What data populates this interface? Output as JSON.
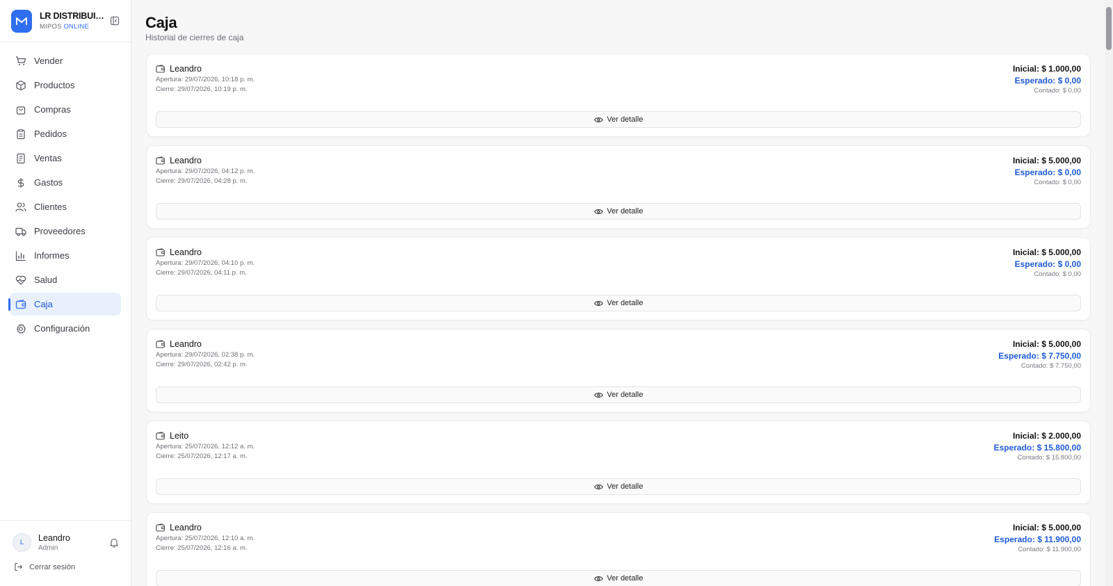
{
  "brand": {
    "name": "LR DISTRIBUIDORA",
    "sub_prefix": "MIPOS",
    "sub_highlight": "ONLINE"
  },
  "nav": [
    {
      "label": "Vender",
      "icon": "cart-icon"
    },
    {
      "label": "Productos",
      "icon": "box-icon"
    },
    {
      "label": "Compras",
      "icon": "shopping-bag-icon"
    },
    {
      "label": "Pedidos",
      "icon": "clipboard-icon"
    },
    {
      "label": "Ventas",
      "icon": "receipt-icon"
    },
    {
      "label": "Gastos",
      "icon": "dollar-icon"
    },
    {
      "label": "Clientes",
      "icon": "users-icon"
    },
    {
      "label": "Proveedores",
      "icon": "truck-icon"
    },
    {
      "label": "Informes",
      "icon": "bar-chart-icon"
    },
    {
      "label": "Salud",
      "icon": "heart-pulse-icon"
    },
    {
      "label": "Caja",
      "icon": "wallet-icon",
      "active": true
    },
    {
      "label": "Configuración",
      "icon": "gear-icon"
    }
  ],
  "user": {
    "initial": "L",
    "name": "Leandro",
    "role": "Admin",
    "logout_label": "Cerrar sesión"
  },
  "page": {
    "title": "Caja",
    "subtitle": "Historial de cierres de caja"
  },
  "closures": [
    {
      "cashier": "Leandro",
      "apertura": "Apertura: 29/07/2026, 10:18 p. m.",
      "cierre": "Cierre: 29/07/2026, 10:19 p. m.",
      "inicial": "Inicial: $ 1.000,00",
      "esperado": "Esperado: $ 0,00",
      "contado": "Contado: $ 0,00",
      "button": "Ver detalle"
    },
    {
      "cashier": "Leandro",
      "apertura": "Apertura: 29/07/2026, 04:12 p. m.",
      "cierre": "Cierre: 29/07/2026, 04:28 p. m.",
      "inicial": "Inicial: $ 5.000,00",
      "esperado": "Esperado: $ 0,00",
      "contado": "Contado: $ 0,00",
      "button": "Ver detalle"
    },
    {
      "cashier": "Leandro",
      "apertura": "Apertura: 29/07/2026, 04:10 p. m.",
      "cierre": "Cierre: 29/07/2026, 04:11 p. m.",
      "inicial": "Inicial: $ 5.000,00",
      "esperado": "Esperado: $ 0,00",
      "contado": "Contado: $ 0,00",
      "button": "Ver detalle"
    },
    {
      "cashier": "Leandro",
      "apertura": "Apertura: 29/07/2026, 02:38 p. m.",
      "cierre": "Cierre: 29/07/2026, 02:42 p. m.",
      "inicial": "Inicial: $ 5.000,00",
      "esperado": "Esperado: $ 7.750,00",
      "contado": "Contado: $ 7.750,00",
      "button": "Ver detalle"
    },
    {
      "cashier": "Leito",
      "apertura": "Apertura: 25/07/2026, 12:12 a. m.",
      "cierre": "Cierre: 25/07/2026, 12:17 a. m.",
      "inicial": "Inicial: $ 2.000,00",
      "esperado": "Esperado: $ 15.800,00",
      "contado": "Contado: $ 15.800,00",
      "button": "Ver detalle"
    },
    {
      "cashier": "Leandro",
      "apertura": "Apertura: 25/07/2026, 12:10 a. m.",
      "cierre": "Cierre: 25/07/2026, 12:16 a. m.",
      "inicial": "Inicial: $ 5.000,00",
      "esperado": "Esperado: $ 11.900,00",
      "contado": "Contado: $ 11.900,00",
      "button": "Ver detalle"
    }
  ],
  "colors": {
    "accent": "#2f6fef",
    "expected_text": "#1e5ad8"
  }
}
